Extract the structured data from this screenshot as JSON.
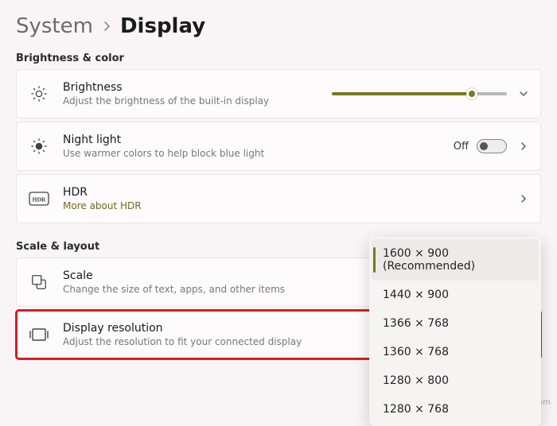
{
  "breadcrumb": {
    "parent": "System",
    "current": "Display"
  },
  "sections": {
    "brightness_color": "Brightness & color",
    "scale_layout": "Scale & layout"
  },
  "brightness": {
    "title": "Brightness",
    "subtitle": "Adjust the brightness of the built-in display",
    "slider_pct": 80
  },
  "night_light": {
    "title": "Night light",
    "subtitle": "Use warmer colors to help block blue light",
    "state_label": "Off",
    "on": false
  },
  "hdr": {
    "title": "HDR",
    "link": "More about HDR"
  },
  "scale": {
    "title": "Scale",
    "subtitle": "Change the size of text, apps, and other items"
  },
  "resolution": {
    "title": "Display resolution",
    "subtitle": "Adjust the resolution to fit your connected display"
  },
  "resolution_options": [
    {
      "label": "1600 × 900 (Recommended)",
      "selected": true
    },
    {
      "label": "1440 × 900",
      "selected": false
    },
    {
      "label": "1366 × 768",
      "selected": false
    },
    {
      "label": "1360 × 768",
      "selected": false
    },
    {
      "label": "1280 × 800",
      "selected": false
    },
    {
      "label": "1280 × 768",
      "selected": false
    }
  ],
  "watermark": "wsxdn.com"
}
